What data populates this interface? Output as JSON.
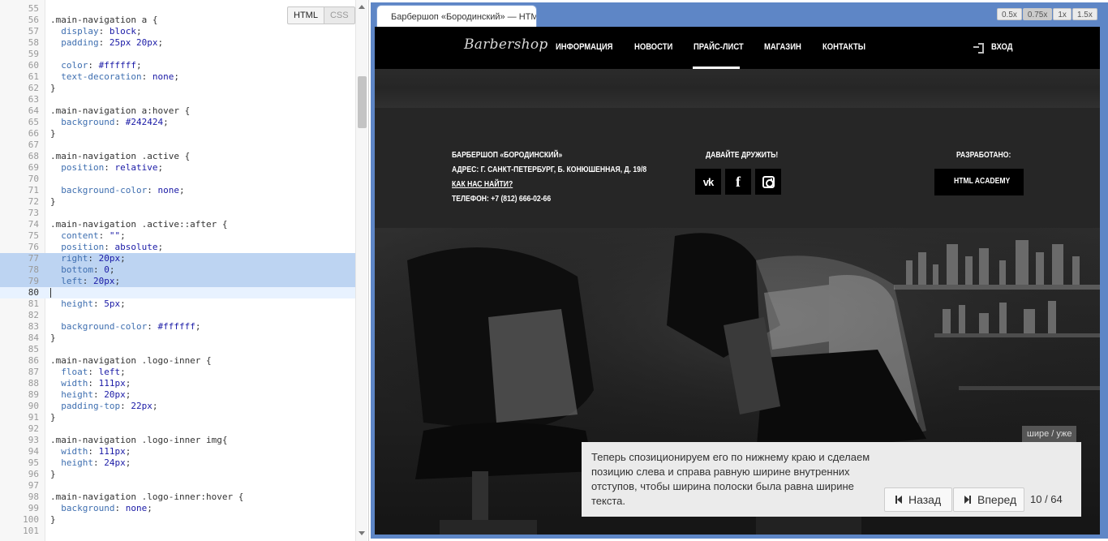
{
  "editor": {
    "tabs": {
      "html": "HTML",
      "css": "CSS"
    },
    "lines": [
      {
        "n": "55"
      },
      {
        "n": "56",
        "sel": ".main-navigation a",
        "p": " {"
      },
      {
        "n": "57",
        "prop": "display",
        "val": "block"
      },
      {
        "n": "58",
        "prop": "padding",
        "val": "25px 20px"
      },
      {
        "n": "59"
      },
      {
        "n": "60",
        "prop": "color",
        "val": "#ffffff"
      },
      {
        "n": "61",
        "prop": "text-decoration",
        "val": "none"
      },
      {
        "n": "62",
        "p": "}"
      },
      {
        "n": "63"
      },
      {
        "n": "64",
        "sel": ".main-navigation a:hover",
        "p": " {"
      },
      {
        "n": "65",
        "prop": "background",
        "val": "#242424"
      },
      {
        "n": "66",
        "p": "}"
      },
      {
        "n": "67"
      },
      {
        "n": "68",
        "sel": ".main-navigation .active",
        "p": " {"
      },
      {
        "n": "69",
        "prop": "position",
        "val": "relative"
      },
      {
        "n": "70"
      },
      {
        "n": "71",
        "prop": "background-color",
        "val": "none"
      },
      {
        "n": "72",
        "p": "}"
      },
      {
        "n": "73"
      },
      {
        "n": "74",
        "sel": ".main-navigation .active::after",
        "p": " {"
      },
      {
        "n": "75",
        "prop": "content",
        "val": "\"\""
      },
      {
        "n": "76",
        "prop": "position",
        "val": "absolute"
      },
      {
        "n": "77",
        "prop": "right",
        "val": "20px",
        "hl": true
      },
      {
        "n": "78",
        "prop": "bottom",
        "val": "0",
        "hl": true
      },
      {
        "n": "79",
        "prop": "left",
        "val": "20px",
        "hl": true
      },
      {
        "n": "80",
        "cur": true
      },
      {
        "n": "81",
        "prop": "height",
        "val": "5px"
      },
      {
        "n": "82"
      },
      {
        "n": "83",
        "prop": "background-color",
        "val": "#ffffff"
      },
      {
        "n": "84",
        "p": "}"
      },
      {
        "n": "85"
      },
      {
        "n": "86",
        "sel": ".main-navigation .logo-inner",
        "p": " {"
      },
      {
        "n": "87",
        "prop": "float",
        "val": "left"
      },
      {
        "n": "88",
        "prop": "width",
        "val": "111px"
      },
      {
        "n": "89",
        "prop": "height",
        "val": "20px"
      },
      {
        "n": "90",
        "prop": "padding-top",
        "val": "22px"
      },
      {
        "n": "91",
        "p": "}"
      },
      {
        "n": "92"
      },
      {
        "n": "93",
        "sel": ".main-navigation .logo-inner img",
        "p": "{"
      },
      {
        "n": "94",
        "prop": "width",
        "val": "111px"
      },
      {
        "n": "95",
        "prop": "height",
        "val": "24px"
      },
      {
        "n": "96",
        "p": "}"
      },
      {
        "n": "97"
      },
      {
        "n": "98",
        "sel": ".main-navigation .logo-inner:hover",
        "p": " {"
      },
      {
        "n": "99",
        "prop": "background",
        "val": "none"
      },
      {
        "n": "100",
        "p": "}"
      },
      {
        "n": "101"
      }
    ]
  },
  "preview": {
    "tab_title": "Барбершоп «Бородинский» — HTM",
    "zoom": [
      "0.5x",
      "0.75x",
      "1x",
      "1.5x"
    ],
    "zoom_active": "0.75x"
  },
  "site": {
    "logo": "Barbershop",
    "nav": [
      "ИНФОРМАЦИЯ",
      "НОВОСТИ",
      "ПРАЙС-ЛИСТ",
      "МАГАЗИН",
      "КОНТАКТЫ"
    ],
    "nav_active": "ПРАЙС-ЛИСТ",
    "login": "ВХОД",
    "contacts": {
      "name": "БАРБЕРШОП «БОРОДИНСКИЙ»",
      "address": "АДРЕС: Г. САНКТ-ПЕТЕРБУРГ, Б. КОНЮШЕННАЯ, Д. 19/8",
      "how_to_find": "КАК НАС НАЙТИ?",
      "phone": "ТЕЛЕФОН: +7 (812) 666-02-66"
    },
    "social": {
      "heading": "ДАВАЙТЕ ДРУЖИТЬ!",
      "items": [
        "vk-icon",
        "facebook-icon",
        "instagram-icon"
      ],
      "vk": "vk",
      "fb": "f"
    },
    "developer": {
      "heading": "РАЗРАБОТАНО:",
      "button": "HTML ACADEMY"
    }
  },
  "tutorial": {
    "text": "Теперь спозиционируем его по нижнему краю и сделаем позицию слева и справа равную ширине внутренних отступов, чтобы ширина полоски была равна ширине текста.",
    "wider": "шире / уже",
    "back": "Назад",
    "forward": "Вперед",
    "counter": "10 / 64"
  },
  "colors": {
    "preview_frame": "#5e86c6",
    "highlight": "#bdd4f2",
    "site_nav": "#000000",
    "footer": "#262626",
    "tip_panel": "#ebebeb"
  }
}
